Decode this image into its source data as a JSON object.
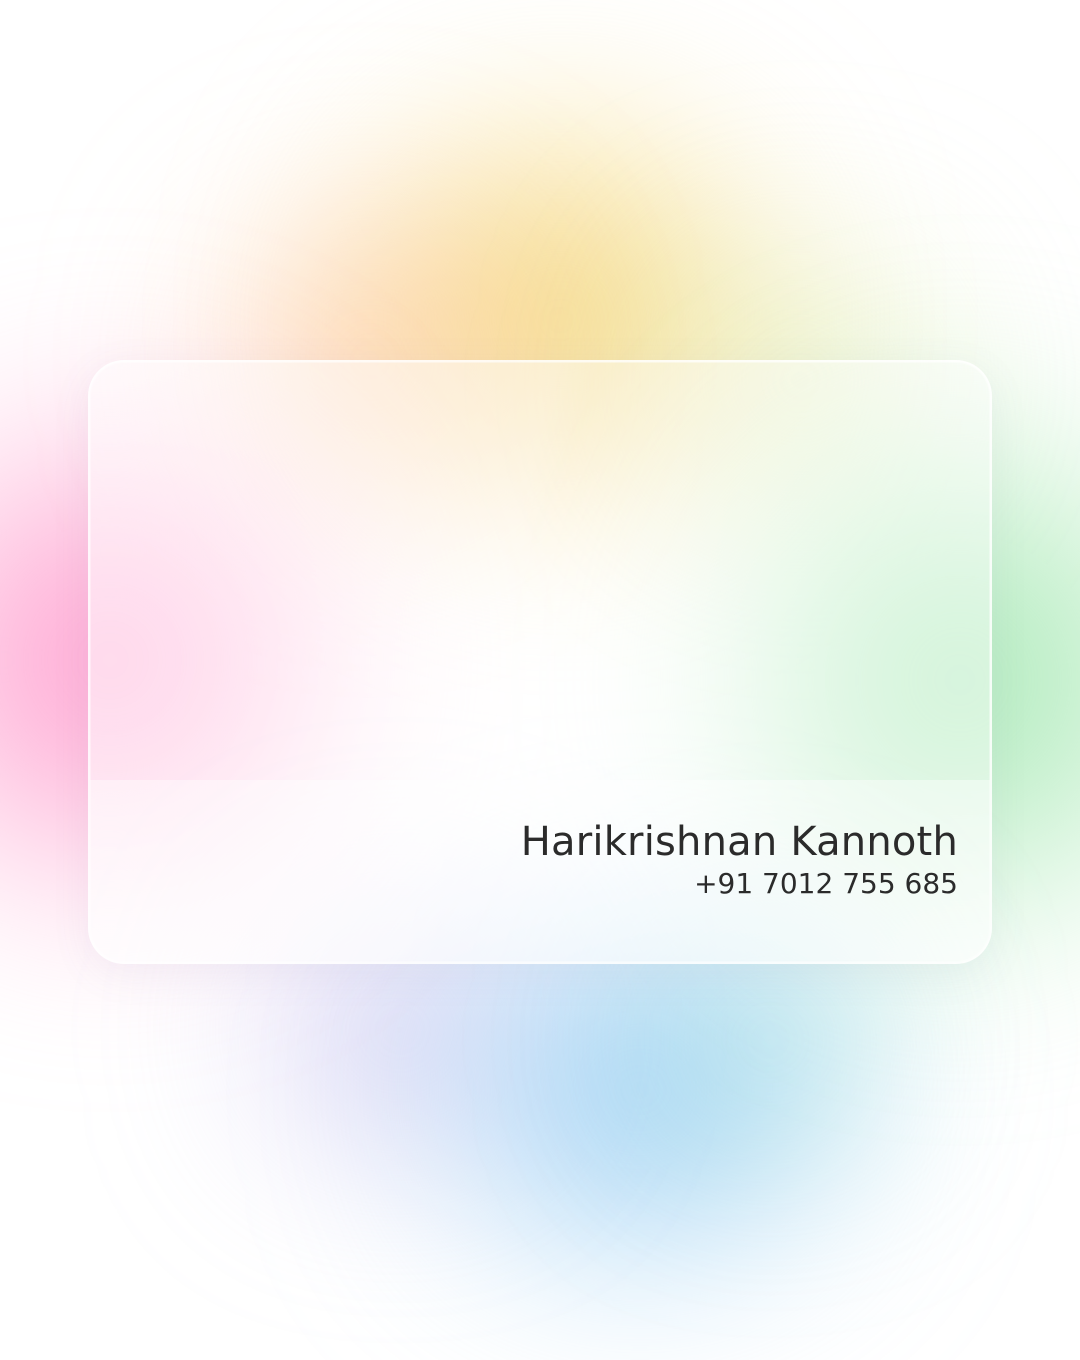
{
  "card": {
    "name": "Harikrishnan Kannoth",
    "phone": "+91 7012 755 685"
  },
  "colors": {
    "text": "#2b2b2b",
    "blob_yellow": "#f0cd5a",
    "blob_pink": "#ff78be",
    "blob_green": "#8ce1a0",
    "blob_blue": "#78bef0",
    "blob_violet": "#afa5e6"
  }
}
